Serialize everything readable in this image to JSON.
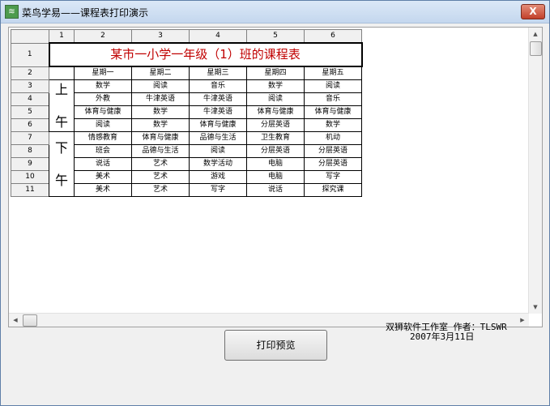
{
  "window": {
    "title": "菜鸟学易——课程表打印演示",
    "icon": "app-logo-icon",
    "close_glyph": "X"
  },
  "sheet": {
    "column_headers": [
      "1",
      "2",
      "3",
      "4",
      "5",
      "6"
    ],
    "row_headers": [
      "1",
      "2",
      "3",
      "4",
      "5",
      "6",
      "7",
      "8",
      "9",
      "10",
      "11"
    ],
    "title": "某市一小学一年级（1）班的课程表",
    "periods": {
      "morning": [
        "上",
        "午"
      ],
      "afternoon": [
        "下",
        "午"
      ]
    },
    "weekdays": [
      "星期一",
      "星期二",
      "星期三",
      "星期四",
      "星期五"
    ],
    "schedule": [
      [
        "数学",
        "阅读",
        "音乐",
        "数学",
        "阅读"
      ],
      [
        "外教",
        "牛津英语",
        "牛津英语",
        "阅读",
        "音乐"
      ],
      [
        "体育与健康",
        "数学",
        "牛津英语",
        "体育与健康",
        "体育与健康"
      ],
      [
        "阅读",
        "数学",
        "体育与健康",
        "分层英语",
        "数学"
      ],
      [
        "情感教育",
        "体育与健康",
        "品德与生活",
        "卫生教育",
        "机动"
      ],
      [
        "班会",
        "品德与生活",
        "阅读",
        "分层英语",
        "分层英语"
      ],
      [
        "说话",
        "艺术",
        "数学活动",
        "电脑",
        "分层英语"
      ],
      [
        "美术",
        "艺术",
        "游戏",
        "电脑",
        "写字"
      ],
      [
        "美术",
        "艺术",
        "写字",
        "说话",
        "探究课"
      ]
    ]
  },
  "credit": {
    "line1": "双狮软件工作室  作者：TLSWR",
    "line2": "2007年3月11日"
  },
  "buttons": {
    "print_preview": "打印预览"
  },
  "colors": {
    "title_text": "#c00000"
  }
}
